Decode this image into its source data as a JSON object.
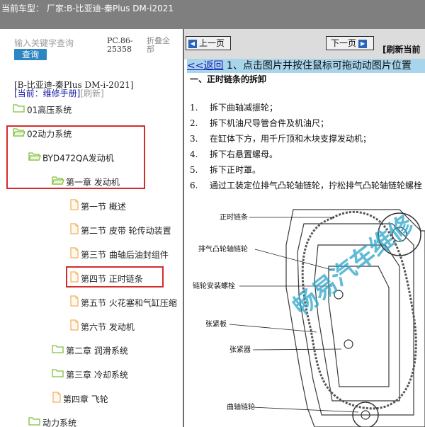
{
  "header": {
    "vehicle_label": "当前车型：",
    "vehicle_value": "厂家:B-比亚迪-秦Plus DM-i2021"
  },
  "sidebar": {
    "search_placeholder": "输入关键字查询",
    "search_button": "查询",
    "pc_code": "PC.86-25358",
    "collapse_all": "折叠全部",
    "car_info": "[B-比亚迪-秦Plus DM-i-2021]",
    "current_prefix": "[当前：维修手册]",
    "refresh": "[刷新]",
    "tree": [
      {
        "label": "01高压系统",
        "icon": "folder-icon"
      },
      {
        "label": "02动力系统",
        "icon": "folder-open-icon"
      },
      {
        "label": "BYD472QA发动机",
        "icon": "folder-open-icon"
      },
      {
        "label": "第一章 发动机",
        "icon": "folder-open-icon"
      },
      {
        "label": "第一节 概述",
        "icon": "document-icon"
      },
      {
        "label": "第二节 皮带 轮传动装置",
        "icon": "document-icon"
      },
      {
        "label": "第三节 曲轴后油封组件",
        "icon": "document-icon"
      },
      {
        "label": "第四节 正时链条",
        "icon": "document-icon"
      },
      {
        "label": "第五节 火花塞和气缸压缩",
        "icon": "document-icon"
      },
      {
        "label": "第六节 发动机",
        "icon": "document-icon"
      },
      {
        "label": "第二章 润滑系统",
        "icon": "folder-icon"
      },
      {
        "label": "第三章 冷却系统",
        "icon": "folder-icon"
      },
      {
        "label": "第四章 飞轮",
        "icon": "document-icon"
      },
      {
        "label": "动力系统",
        "icon": "folder-icon"
      }
    ]
  },
  "content": {
    "prev_button": "上一页",
    "next_button": "下一页",
    "refresh_current": "[刷新当前",
    "back_link": "<<返回",
    "hint": " 1、点击图片并按住鼠标可拖动动图片位置",
    "section_title": "一、正时链条的拆卸",
    "steps": [
      {
        "num": "1.",
        "text": "拆下曲轴减振轮；"
      },
      {
        "num": "2.",
        "text": "拆下机油尺导管合件及机油尺；"
      },
      {
        "num": "3.",
        "text": "在缸体下方，用千斤顶和木块支撑发动机；"
      },
      {
        "num": "4.",
        "text": "拆下右悬置螺母。"
      },
      {
        "num": "5.",
        "text": "拆下正时罩。"
      },
      {
        "num": "6.",
        "text": "通过工装定位排气凸轮轴链轮，拧松排气凸轮轴链轮螺栓"
      }
    ],
    "diagram_labels": [
      "正时链条",
      "排气凸轮轴链轮",
      "链轮安装螺栓",
      "张紧板",
      "张紧器",
      "曲轴链轮"
    ],
    "watermark": "畅易汽车维修"
  },
  "colors": {
    "topbar": "#7f7f7f",
    "search_button": "#2e86c1",
    "highlight": "#d62b2b",
    "hint_background": "#a8d4ec",
    "folder": "#7fbf3f",
    "document": "#f0b060",
    "link": "#1a1ab0"
  }
}
